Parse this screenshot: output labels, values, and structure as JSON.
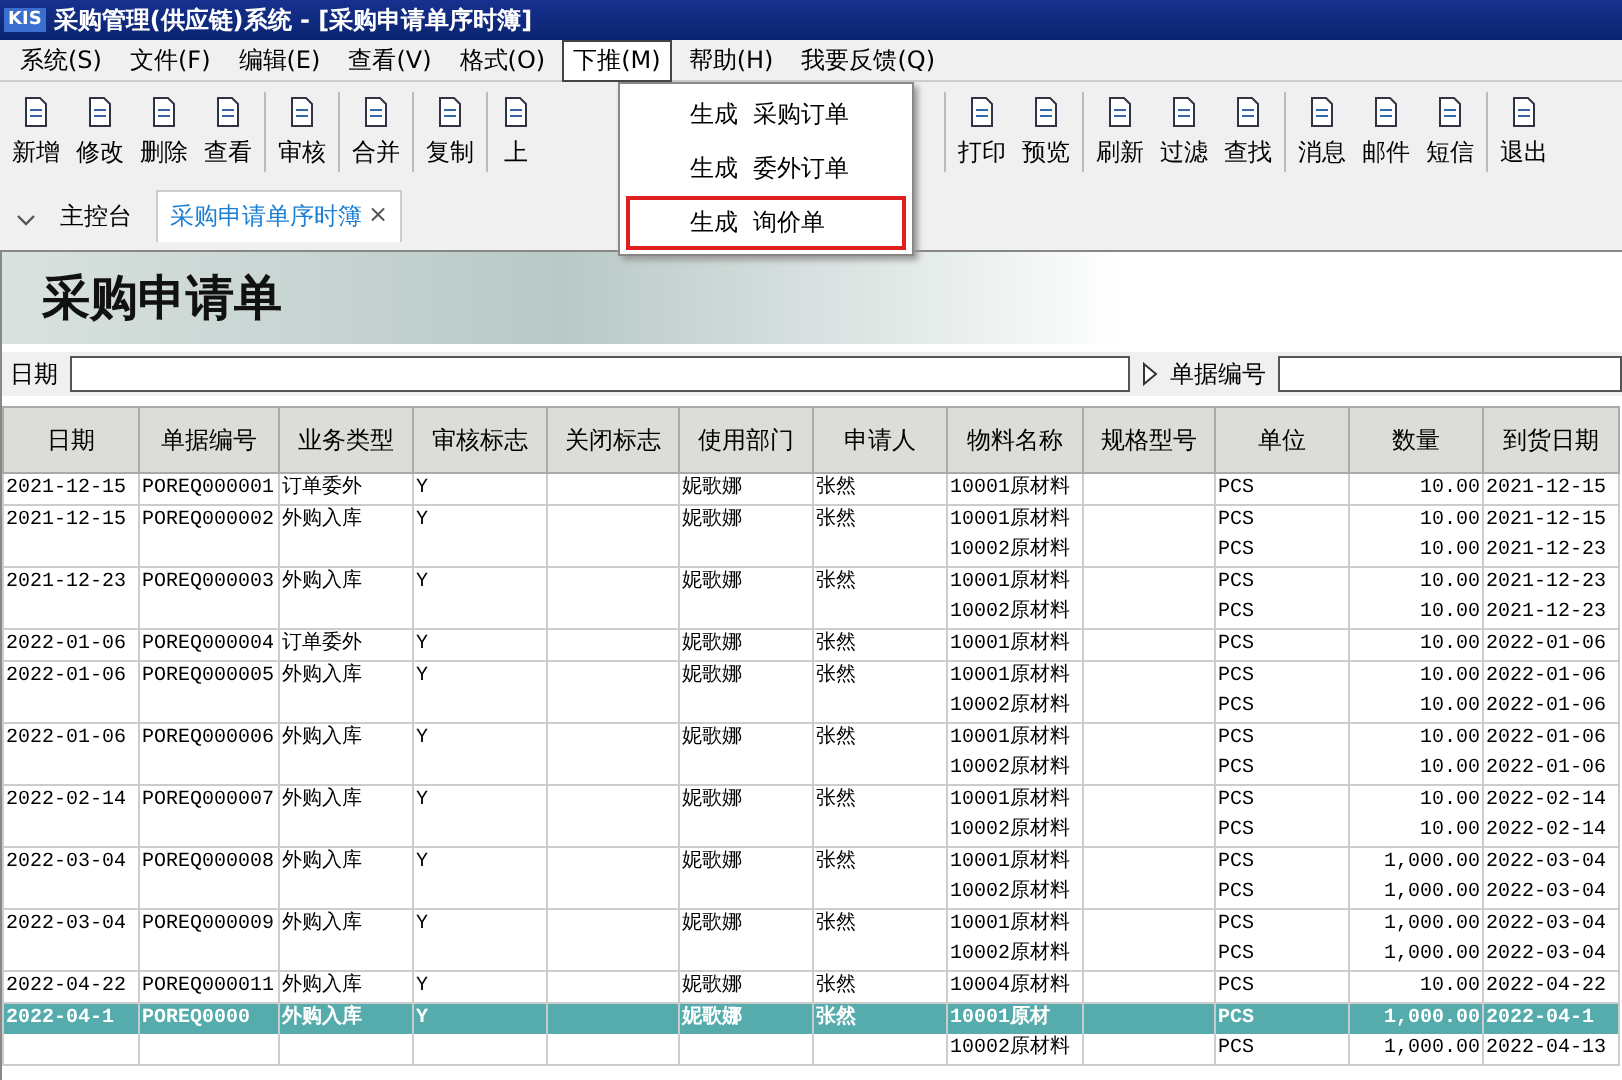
{
  "window": {
    "logo": "KIS",
    "title": "采购管理(供应链)系统 - [采购申请单序时簿]"
  },
  "menu": [
    {
      "label": "系统(S)",
      "selected": false
    },
    {
      "label": "文件(F)",
      "selected": false
    },
    {
      "label": "编辑(E)",
      "selected": false
    },
    {
      "label": "查看(V)",
      "selected": false
    },
    {
      "label": "格式(O)",
      "selected": false
    },
    {
      "label": "下推(M)",
      "selected": true
    },
    {
      "label": "帮助(H)",
      "selected": false
    },
    {
      "label": "我要反馈(Q)",
      "selected": false
    }
  ],
  "dropdown": [
    {
      "verb": "生成",
      "label": "采购订单",
      "highlighted": false
    },
    {
      "verb": "生成",
      "label": "委外订单",
      "highlighted": false
    },
    {
      "verb": "生成",
      "label": "询价单",
      "highlighted": true
    }
  ],
  "toolbar": [
    [
      "新增",
      "修改",
      "删除",
      "查看"
    ],
    [
      "审核"
    ],
    [
      "合并"
    ],
    [
      "复制"
    ],
    [
      "上"
    ],
    [
      "打印",
      "预览"
    ],
    [
      "刷新",
      "过滤",
      "查找"
    ],
    [
      "消息",
      "邮件",
      "短信"
    ],
    [
      "退出"
    ]
  ],
  "tabs": [
    {
      "label": "主控台",
      "selected": false,
      "closable": false
    },
    {
      "label": "采购申请单序时簿",
      "selected": true,
      "closable": true
    }
  ],
  "close_glyph": "×",
  "banner": {
    "title": "采购申请单"
  },
  "filters": [
    {
      "label": "日期"
    },
    {
      "label": "单据编号"
    }
  ],
  "table": {
    "columns": [
      "日期",
      "单据编号",
      "业务类型",
      "审核标志",
      "关闭标志",
      "使用部门",
      "申请人",
      "物料名称",
      "规格型号",
      "单位",
      "数量",
      "到货日期"
    ],
    "rows": [
      {
        "date": "2021-12-15",
        "number": "POREQ000001",
        "type": "订单委外",
        "audit": "Y",
        "dept": "妮歌娜",
        "applicant": "张然",
        "selected": false,
        "lines": [
          {
            "material": "10001原材料",
            "unit": "PCS",
            "qty": "10.00",
            "due": "2021-12-15"
          }
        ]
      },
      {
        "date": "2021-12-15",
        "number": "POREQ000002",
        "type": "外购入库",
        "audit": "Y",
        "dept": "妮歌娜",
        "applicant": "张然",
        "selected": false,
        "lines": [
          {
            "material": "10001原材料",
            "unit": "PCS",
            "qty": "10.00",
            "due": "2021-12-15"
          },
          {
            "material": "10002原材料",
            "unit": "PCS",
            "qty": "10.00",
            "due": "2021-12-23"
          }
        ]
      },
      {
        "date": "2021-12-23",
        "number": "POREQ000003",
        "type": "外购入库",
        "audit": "Y",
        "dept": "妮歌娜",
        "applicant": "张然",
        "selected": false,
        "lines": [
          {
            "material": "10001原材料",
            "unit": "PCS",
            "qty": "10.00",
            "due": "2021-12-23"
          },
          {
            "material": "10002原材料",
            "unit": "PCS",
            "qty": "10.00",
            "due": "2021-12-23"
          }
        ]
      },
      {
        "date": "2022-01-06",
        "number": "POREQ000004",
        "type": "订单委外",
        "audit": "Y",
        "dept": "妮歌娜",
        "applicant": "张然",
        "selected": false,
        "lines": [
          {
            "material": "10001原材料",
            "unit": "PCS",
            "qty": "10.00",
            "due": "2022-01-06"
          }
        ]
      },
      {
        "date": "2022-01-06",
        "number": "POREQ000005",
        "type": "外购入库",
        "audit": "Y",
        "dept": "妮歌娜",
        "applicant": "张然",
        "selected": false,
        "lines": [
          {
            "material": "10001原材料",
            "unit": "PCS",
            "qty": "10.00",
            "due": "2022-01-06"
          },
          {
            "material": "10002原材料",
            "unit": "PCS",
            "qty": "10.00",
            "due": "2022-01-06"
          }
        ]
      },
      {
        "date": "2022-01-06",
        "number": "POREQ000006",
        "type": "外购入库",
        "audit": "Y",
        "dept": "妮歌娜",
        "applicant": "张然",
        "selected": false,
        "lines": [
          {
            "material": "10001原材料",
            "unit": "PCS",
            "qty": "10.00",
            "due": "2022-01-06"
          },
          {
            "material": "10002原材料",
            "unit": "PCS",
            "qty": "10.00",
            "due": "2022-01-06"
          }
        ]
      },
      {
        "date": "2022-02-14",
        "number": "POREQ000007",
        "type": "外购入库",
        "audit": "Y",
        "dept": "妮歌娜",
        "applicant": "张然",
        "selected": false,
        "lines": [
          {
            "material": "10001原材料",
            "unit": "PCS",
            "qty": "10.00",
            "due": "2022-02-14"
          },
          {
            "material": "10002原材料",
            "unit": "PCS",
            "qty": "10.00",
            "due": "2022-02-14"
          }
        ]
      },
      {
        "date": "2022-03-04",
        "number": "POREQ000008",
        "type": "外购入库",
        "audit": "Y",
        "dept": "妮歌娜",
        "applicant": "张然",
        "selected": false,
        "lines": [
          {
            "material": "10001原材料",
            "unit": "PCS",
            "qty": "1,000.00",
            "due": "2022-03-04"
          },
          {
            "material": "10002原材料",
            "unit": "PCS",
            "qty": "1,000.00",
            "due": "2022-03-04"
          }
        ]
      },
      {
        "date": "2022-03-04",
        "number": "POREQ000009",
        "type": "外购入库",
        "audit": "Y",
        "dept": "妮歌娜",
        "applicant": "张然",
        "selected": false,
        "lines": [
          {
            "material": "10001原材料",
            "unit": "PCS",
            "qty": "1,000.00",
            "due": "2022-03-04"
          },
          {
            "material": "10002原材料",
            "unit": "PCS",
            "qty": "1,000.00",
            "due": "2022-03-04"
          }
        ]
      },
      {
        "date": "2022-04-22",
        "number": "POREQ000011",
        "type": "外购入库",
        "audit": "Y",
        "dept": "妮歌娜",
        "applicant": "张然",
        "selected": false,
        "lines": [
          {
            "material": "10004原材料",
            "unit": "PCS",
            "qty": "10.00",
            "due": "2022-04-22"
          }
        ]
      },
      {
        "date": "2022-04-1",
        "number": "POREQ0000",
        "type": "外购入库",
        "audit": "Y",
        "dept": "妮歌娜",
        "applicant": "张然",
        "selected": true,
        "lines": [
          {
            "material": "10001原材",
            "unit": "PCS",
            "qty": "1,000.00",
            "due": "2022-04-1"
          },
          {
            "material": "10002原材料",
            "unit": "PCS",
            "qty": "1,000.00",
            "due": "2022-04-13"
          }
        ]
      }
    ]
  }
}
